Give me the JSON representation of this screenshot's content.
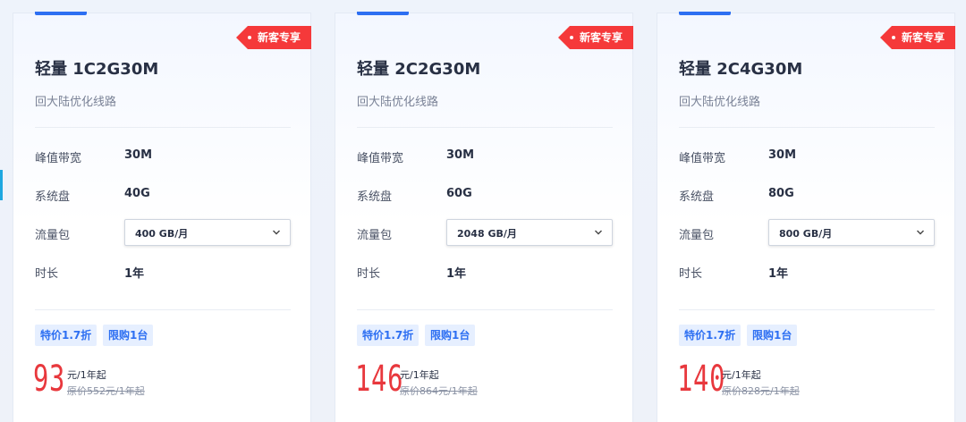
{
  "ribbon_label": "新客专享",
  "labels": {
    "bandwidth": "峰值带宽",
    "disk": "系统盘",
    "traffic": "流量包",
    "duration": "时长"
  },
  "tags": {
    "discount": "特价1.7折",
    "limit": "限购1台"
  },
  "cards": [
    {
      "title": "轻量 1C2G30M",
      "subtitle": "回大陆优化线路",
      "bandwidth": "30M",
      "disk": "40G",
      "traffic": "400 GB/月",
      "duration": "1年",
      "price": "93",
      "price_unit": "元/1年起",
      "original_price": "原价552元/1年起"
    },
    {
      "title": "轻量 2C2G30M",
      "subtitle": "回大陆优化线路",
      "bandwidth": "30M",
      "disk": "60G",
      "traffic": "2048 GB/月",
      "duration": "1年",
      "price": "146",
      "price_unit": "元/1年起",
      "original_price": "原价864元/1年起"
    },
    {
      "title": "轻量 2C4G30M",
      "subtitle": "回大陆优化线路",
      "bandwidth": "30M",
      "disk": "80G",
      "traffic": "800 GB/月",
      "duration": "1年",
      "price": "140",
      "price_unit": "元/1年起",
      "original_price": "原价828元/1年起"
    }
  ],
  "colors": {
    "accent": "#2d6ff2",
    "ribbon": "#f5393a",
    "price": "#e8383d",
    "tag_bg": "#e6efff"
  }
}
